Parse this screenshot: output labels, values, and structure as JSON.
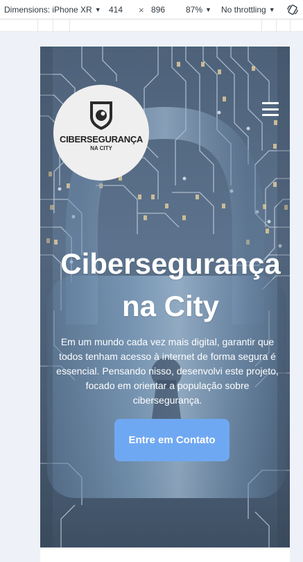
{
  "devtools": {
    "dimensions_label": "Dimensions: iPhone XR",
    "width": "414",
    "times": "×",
    "height": "896",
    "zoom": "87%",
    "throttling": "No throttling",
    "caret": "▼"
  },
  "header": {
    "logo_title": "CIBERSEGURANÇA",
    "logo_subtitle": "NA CITY"
  },
  "hero": {
    "title": "Cibersegurança na City",
    "text": "Em um mundo cada vez mais digital, garantir que todos tenham acesso à internet de forma segura é essencial. Pensando nisso, desenvolvi este projeto, focado em orientar a população sobre cibersegurança.",
    "cta_label": "Entre em Contato"
  },
  "colors": {
    "cta": "#6fa8f2",
    "hero_overlay": "#5d738d",
    "logo_bg": "#efefef"
  }
}
